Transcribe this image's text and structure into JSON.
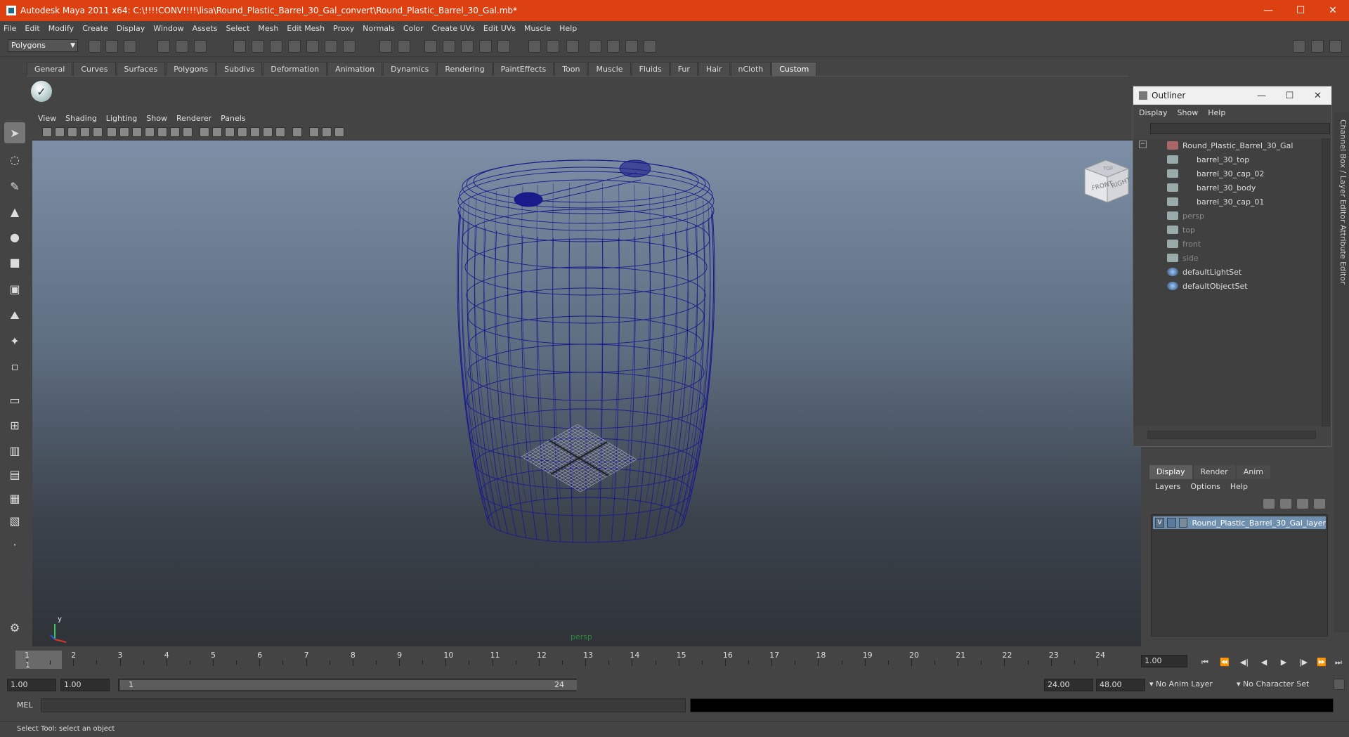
{
  "window": {
    "title": "Autodesk Maya 2011 x64: C:\\!!!!CONV!!!!\\lisa\\Round_Plastic_Barrel_30_Gal_convert\\Round_Plastic_Barrel_30_Gal.mb*"
  },
  "menubar": [
    "File",
    "Edit",
    "Modify",
    "Create",
    "Display",
    "Window",
    "Assets",
    "Select",
    "Mesh",
    "Edit Mesh",
    "Proxy",
    "Normals",
    "Color",
    "Create UVs",
    "Edit UVs",
    "Muscle",
    "Help"
  ],
  "statusline": {
    "mode": "Polygons"
  },
  "shelf": {
    "tabs": [
      "General",
      "Curves",
      "Surfaces",
      "Polygons",
      "Subdivs",
      "Deformation",
      "Animation",
      "Dynamics",
      "Rendering",
      "PaintEffects",
      "Toon",
      "Muscle",
      "Fluids",
      "Fur",
      "Hair",
      "nCloth",
      "Custom"
    ],
    "active": "Custom"
  },
  "viewport": {
    "menus": [
      "View",
      "Shading",
      "Lighting",
      "Show",
      "Renderer",
      "Panels"
    ],
    "camera_label": "persp",
    "viewcube_faces": [
      "FRONT",
      "RIGHT",
      "TOP"
    ]
  },
  "outliner": {
    "title": "Outliner",
    "menus": [
      "Display",
      "Show",
      "Help"
    ],
    "items": [
      {
        "label": "Round_Plastic_Barrel_30_Gal",
        "level": 0,
        "dim": false
      },
      {
        "label": "barrel_30_top",
        "level": 1,
        "dim": false
      },
      {
        "label": "barrel_30_cap_02",
        "level": 1,
        "dim": false
      },
      {
        "label": "barrel_30_body",
        "level": 1,
        "dim": false
      },
      {
        "label": "barrel_30_cap_01",
        "level": 1,
        "dim": false
      },
      {
        "label": "persp",
        "level": 0,
        "dim": true
      },
      {
        "label": "top",
        "level": 0,
        "dim": true
      },
      {
        "label": "front",
        "level": 0,
        "dim": true
      },
      {
        "label": "side",
        "level": 0,
        "dim": true
      },
      {
        "label": "defaultLightSet",
        "level": 0,
        "dim": false
      },
      {
        "label": "defaultObjectSet",
        "level": 0,
        "dim": false
      }
    ]
  },
  "sidetabs": [
    "Channel Box / Layer Editor",
    "Attribute Editor"
  ],
  "layers": {
    "tabs": [
      "Display",
      "Render",
      "Anim"
    ],
    "active": "Display",
    "menus": [
      "Layers",
      "Options",
      "Help"
    ],
    "row": {
      "visible": "V",
      "name": "Round_Plastic_Barrel_30_Gal_layer"
    }
  },
  "timeline": {
    "ticks": [
      "1",
      "2",
      "3",
      "4",
      "5",
      "6",
      "7",
      "8",
      "9",
      "10",
      "11",
      "12",
      "13",
      "14",
      "15",
      "16",
      "17",
      "18",
      "19",
      "20",
      "21",
      "22",
      "23",
      "24"
    ],
    "current": "1",
    "current_field": "1.00"
  },
  "range": {
    "start": "1.00",
    "start2": "1.00",
    "slider_start": "1",
    "slider_end": "24",
    "end": "24.00",
    "end2": "48.00",
    "anim_layer": "No Anim Layer",
    "char_set": "No Character Set"
  },
  "mel": {
    "label": "MEL"
  },
  "help": {
    "text": "Select Tool: select an object"
  }
}
